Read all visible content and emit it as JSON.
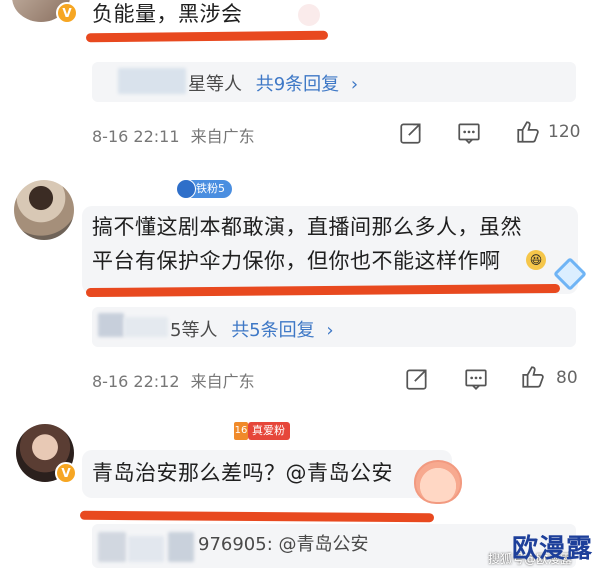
{
  "comments": [
    {
      "text": "负能量，黑涉会",
      "replies_prefix": "星等人",
      "replies_count": "共9条回复",
      "time": "8-16 22:11",
      "location": "来自广东",
      "likes": "120"
    },
    {
      "badge": "铁粉5",
      "text_line1": "搞不懂这剧本都敢演，直播间那么多人，虽然",
      "text_line2": "平台有保护伞力保你，但你也不能这样作啊",
      "replies_prefix": "5等人",
      "replies_count": "共5条回复",
      "time": "8-16 22:12",
      "location": "来自广东",
      "likes": "80"
    },
    {
      "badge": "真爱粉",
      "text": "青岛治安那么差吗？@青岛公安",
      "reply_preview": "976905: @青岛公安"
    }
  ],
  "watermark": {
    "small": "搜狐号@欧漫露",
    "big": "欧漫露"
  },
  "colors": {
    "underline": "#e8491f",
    "link_blue": "#3e78c6",
    "verified_badge": "#f6a623",
    "fan_badge": "#4a8ee0",
    "love_badge": "#e6463a"
  },
  "icons": [
    "share-icon",
    "comment-icon",
    "like-icon",
    "v-badge-icon",
    "smile-emoji-icon",
    "diamond-icon",
    "peach-sticker-icon"
  ]
}
